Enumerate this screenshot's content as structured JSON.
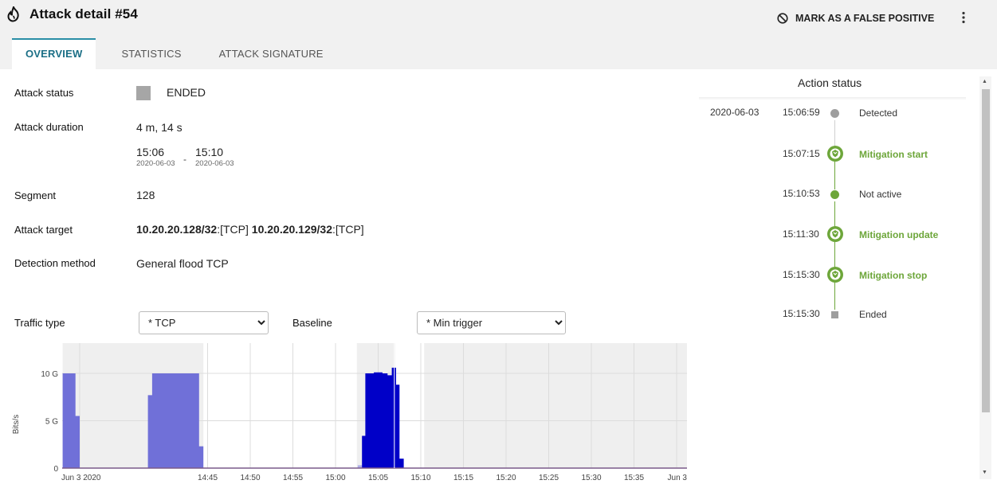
{
  "header": {
    "title": "Attack detail #54",
    "logo_icon": "flame-icon",
    "false_positive_label": "MARK AS A FALSE POSITIVE",
    "false_positive_icon": "ban-icon",
    "more_icon": "kebab-menu-icon"
  },
  "tabs": [
    {
      "label": "OVERVIEW",
      "active": true
    },
    {
      "label": "STATISTICS",
      "active": false
    },
    {
      "label": "ATTACK SIGNATURE",
      "active": false
    }
  ],
  "details": {
    "status_label": "Attack status",
    "status_value": "ENDED",
    "duration_label": "Attack duration",
    "duration_value": "4 m, 14 s",
    "start_time": "15:06",
    "start_date": "2020-06-03",
    "end_time": "15:10",
    "end_date": "2020-06-03",
    "separator": "-",
    "segment_label": "Segment",
    "segment_value": "128",
    "target_label": "Attack target",
    "targets": [
      {
        "ip": "10.20.20.128/32",
        "proto": ":[TCP]"
      },
      {
        "ip": "10.20.20.129/32",
        "proto": ":[TCP]"
      }
    ],
    "method_label": "Detection method",
    "method_value": "General flood TCP"
  },
  "filters": {
    "traffic_label": "Traffic type",
    "traffic_value": "* TCP",
    "baseline_label": "Baseline",
    "baseline_value": "* Min trigger"
  },
  "chart_data": {
    "type": "area",
    "ylabel": "Bits/s",
    "yticks": [
      "0",
      "5 G",
      "10 G"
    ],
    "ylim_gbps": [
      0,
      13
    ],
    "xticks": [
      "Jun 3 2020",
      "14:45",
      "14:50",
      "14:55",
      "15:00",
      "15:05",
      "15:10",
      "15:15",
      "15:20",
      "15:25",
      "15:30",
      "15:35",
      "Jun 3"
    ],
    "x_minutes": [
      0,
      15,
      20,
      25,
      30,
      35,
      40,
      45,
      50,
      55,
      60,
      65,
      70
    ],
    "shaded_ranges_minutes": [
      [
        -2,
        14.5
      ],
      [
        32.5,
        37
      ]
    ],
    "active_range_minutes": [
      37,
      40.3
    ],
    "colors": {
      "background_series": "#7070d8",
      "attack_series": "#0000c8",
      "shade": "#efefef",
      "grid": "#dcdcdc"
    },
    "series": [
      {
        "name": "",
        "color": "#7070d8",
        "points": [
          [
            -2,
            0
          ],
          [
            -2,
            10
          ],
          [
            -0.5,
            10
          ],
          [
            -0.5,
            5.5
          ],
          [
            0,
            5.5
          ],
          [
            0,
            0
          ],
          [
            8,
            0
          ],
          [
            8,
            7.7
          ],
          [
            8.5,
            7.7
          ],
          [
            8.5,
            10
          ],
          [
            14,
            10
          ],
          [
            14,
            2.3
          ],
          [
            14.5,
            2.3
          ],
          [
            14.5,
            0
          ]
        ]
      },
      {
        "name": "",
        "color": "#b0b0e8",
        "points": [
          [
            32.6,
            0
          ],
          [
            32.6,
            0.3
          ],
          [
            33.1,
            0.3
          ],
          [
            33.1,
            0
          ]
        ]
      },
      {
        "name": "",
        "color": "#0000c8",
        "points": [
          [
            33.1,
            0
          ],
          [
            33.1,
            3.4
          ],
          [
            33.5,
            3.4
          ],
          [
            33.5,
            10
          ],
          [
            34.5,
            10
          ],
          [
            34.5,
            10.1
          ],
          [
            35.5,
            10.1
          ],
          [
            35.5,
            10
          ],
          [
            36.1,
            10
          ],
          [
            36.1,
            9.8
          ],
          [
            36.6,
            9.8
          ],
          [
            36.6,
            10.6
          ],
          [
            37.1,
            10.6
          ],
          [
            37.1,
            8.8
          ],
          [
            37.5,
            8.8
          ],
          [
            37.5,
            1
          ],
          [
            38,
            1
          ],
          [
            38,
            0
          ]
        ]
      }
    ]
  },
  "action_status": {
    "title": "Action status",
    "events": [
      {
        "date": "2020-06-03",
        "time": "15:06:59",
        "label": "Detected",
        "kind": "dot-gray",
        "highlight": false
      },
      {
        "date": "",
        "time": "15:07:15",
        "label": "Mitigation start",
        "kind": "shield",
        "highlight": true
      },
      {
        "date": "",
        "time": "15:10:53",
        "label": "Not active",
        "kind": "dot-green",
        "highlight": false
      },
      {
        "date": "",
        "time": "15:11:30",
        "label": "Mitigation update",
        "kind": "shield",
        "highlight": true
      },
      {
        "date": "",
        "time": "15:15:30",
        "label": "Mitigation stop",
        "kind": "shield",
        "highlight": true
      },
      {
        "date": "",
        "time": "15:15:30",
        "label": "Ended",
        "kind": "square-gray",
        "highlight": false
      }
    ],
    "colors": {
      "green": "#6da63a",
      "gray": "#9e9e9e"
    }
  }
}
